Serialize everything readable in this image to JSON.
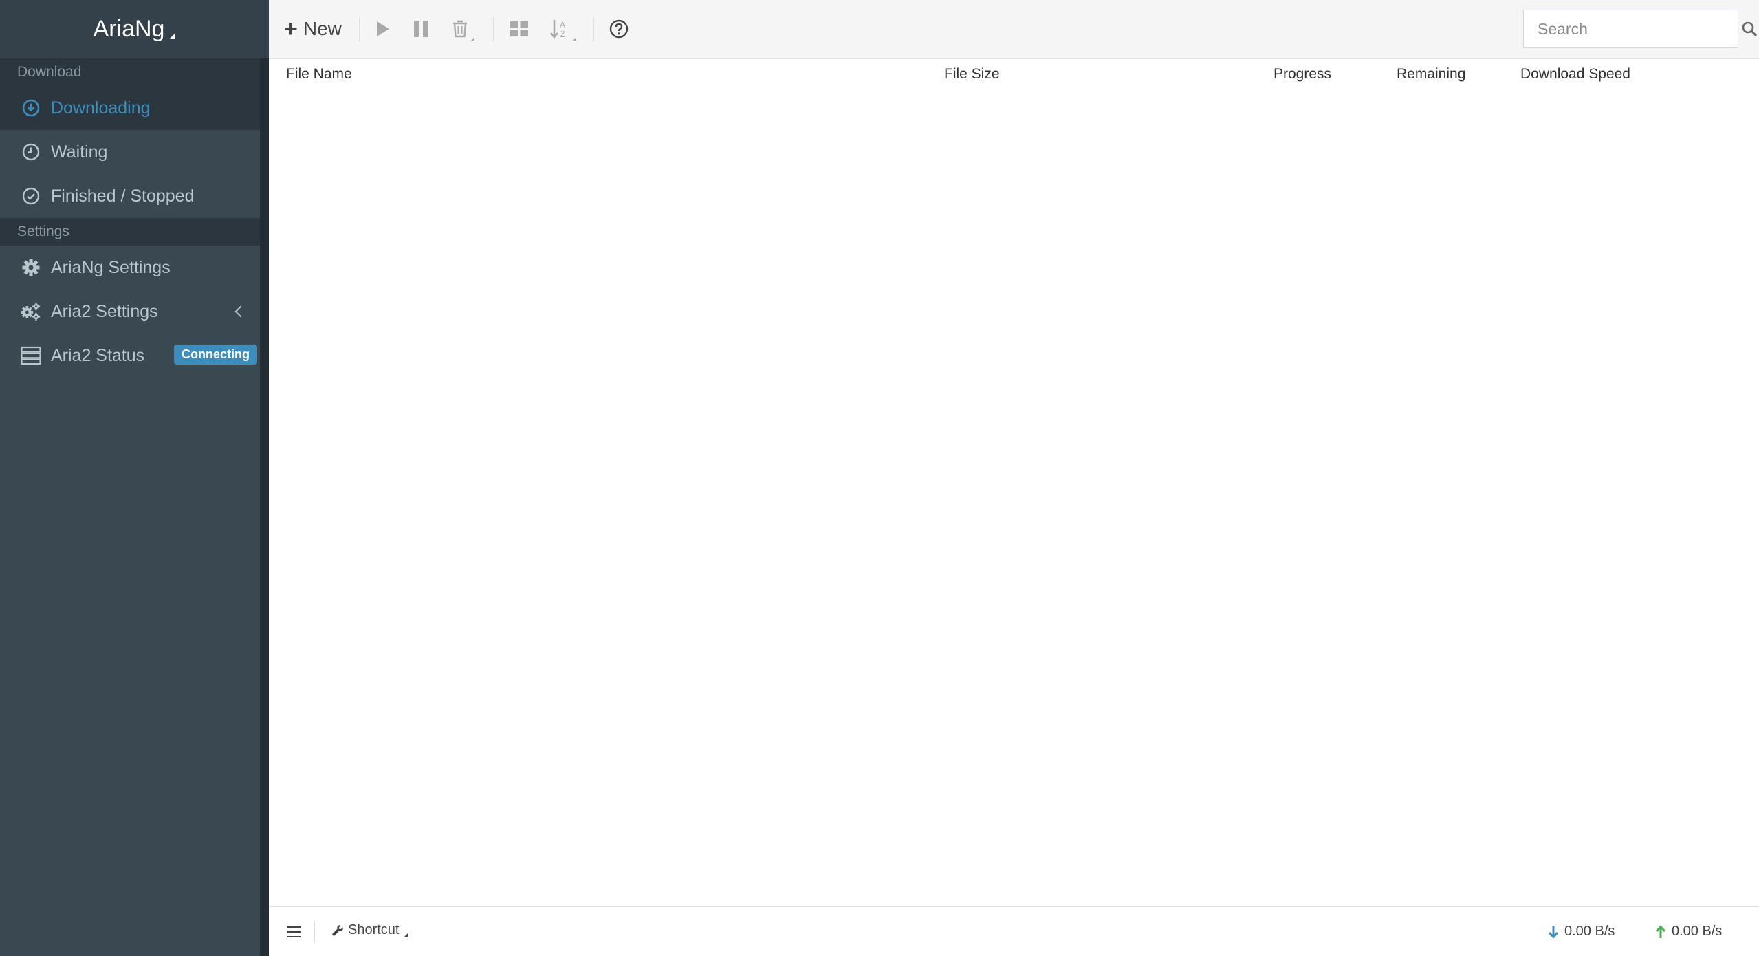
{
  "brand": {
    "title": "AriaNg"
  },
  "sidebar": {
    "sections": [
      {
        "header": "Download",
        "items": [
          {
            "label": "Downloading",
            "icon": "arrow-circle-down-icon",
            "active": true
          },
          {
            "label": "Waiting",
            "icon": "clock-icon"
          },
          {
            "label": "Finished / Stopped",
            "icon": "check-circle-icon"
          }
        ]
      },
      {
        "header": "Settings",
        "items": [
          {
            "label": "AriaNg Settings",
            "icon": "gear-icon"
          },
          {
            "label": "Aria2 Settings",
            "icon": "gears-icon"
          },
          {
            "label": "Aria2 Status",
            "icon": "server-icon",
            "badge": "Connecting"
          }
        ]
      }
    ]
  },
  "toolbar": {
    "new_label": "New",
    "search_placeholder": "Search"
  },
  "table": {
    "columns": [
      "File Name",
      "File Size",
      "Progress",
      "Remaining",
      "Download Speed"
    ],
    "rows": []
  },
  "footer": {
    "shortcut_label": "Shortcut",
    "download_speed": "0.00 B/s",
    "upload_speed": "0.00 B/s"
  },
  "colors": {
    "sidebar_bg": "#3a4852",
    "accent": "#3c8dbc",
    "download_arrow": "#3c8dbc",
    "upload_arrow": "#4caf50"
  }
}
